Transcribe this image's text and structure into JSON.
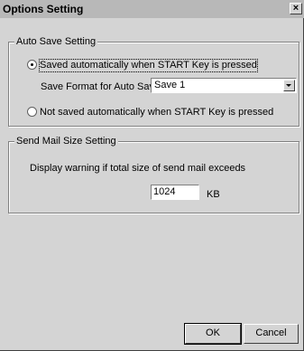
{
  "window": {
    "title": "Options Setting",
    "close_glyph": "×"
  },
  "auto_save": {
    "legend": "Auto Save Setting",
    "option_auto_label": "Saved automatically when START Key is pressed",
    "option_auto_selected": true,
    "format_label": "Save Format for Auto Save:",
    "format_value": "Save 1",
    "option_manual_label": "Not saved automatically when START Key is pressed",
    "option_manual_selected": false
  },
  "send_mail": {
    "legend": "Send Mail Size Setting",
    "warning_label": "Display warning if total size of send mail exceeds",
    "size_value": "1024",
    "unit": "KB"
  },
  "buttons": {
    "ok_label": "OK",
    "cancel_label": "Cancel"
  }
}
